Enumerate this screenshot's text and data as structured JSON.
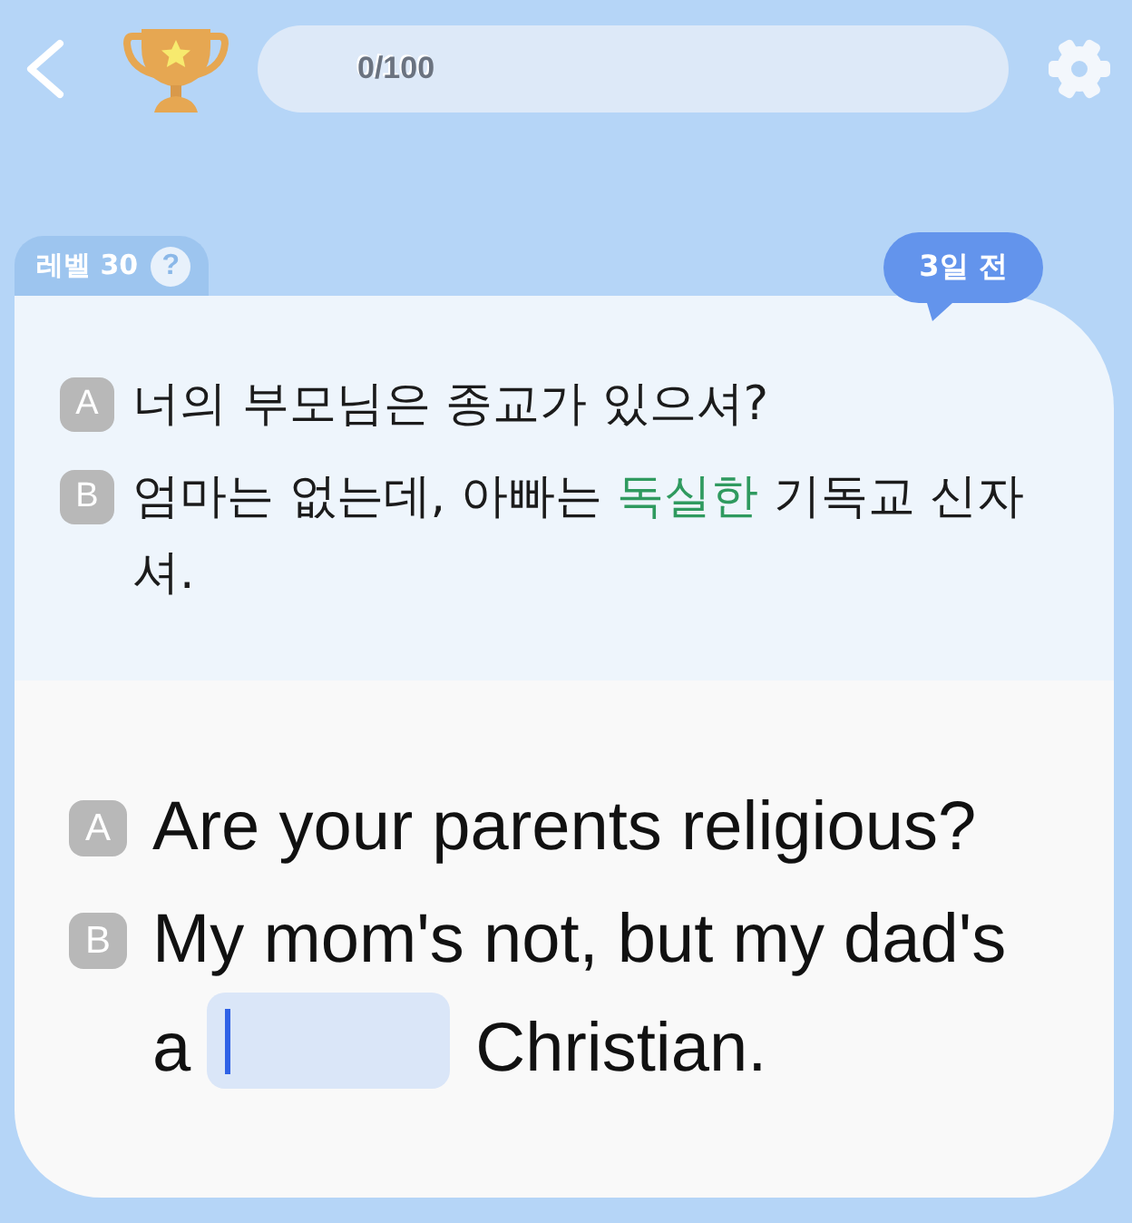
{
  "top_bar": {
    "progress_label": "0/100"
  },
  "level_tab": {
    "label": "레벨 30",
    "help": "?"
  },
  "time_badge": "3일 전",
  "korean_dialogue": [
    {
      "speaker": "A",
      "segments": [
        {
          "text": "너의 부모님은 종교가 있으셔?",
          "highlighted": false
        }
      ]
    },
    {
      "speaker": "B",
      "segments": [
        {
          "text": "엄마는 없는데, 아빠는 ",
          "highlighted": false
        },
        {
          "text": "독실한",
          "highlighted": true
        },
        {
          "text": " 기독교 신자셔.",
          "highlighted": false
        }
      ]
    }
  ],
  "english_dialogue": [
    {
      "speaker": "A",
      "kind": "text",
      "text": "Are your parents religious?"
    },
    {
      "speaker": "B",
      "kind": "blank",
      "lines": [
        [
          {
            "kind": "text",
            "text": "My mom's not, but my dad's"
          }
        ],
        [
          {
            "kind": "text",
            "text": "a"
          },
          {
            "kind": "blank",
            "focused": true
          },
          {
            "kind": "text",
            "text": "Christian."
          }
        ]
      ]
    }
  ]
}
